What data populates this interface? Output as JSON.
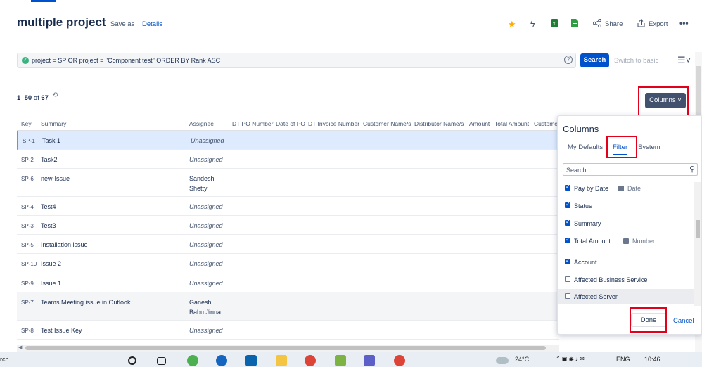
{
  "header": {
    "title": "multiple project",
    "save_as": "Save as",
    "details": "Details",
    "share": "Share",
    "export": "Export"
  },
  "search": {
    "query": "project = SP OR project = \"Component test\" ORDER BY Rank ASC",
    "search_button": "Search",
    "switch_label": "Switch to basic"
  },
  "results": {
    "range": "1–50",
    "of_label": "of",
    "total": "67",
    "columns_button": "Columns ˅"
  },
  "table": {
    "headers": [
      "Key",
      "Summary",
      "Assignee",
      "DT PO Number",
      "Date of PO",
      "DT Invoice Number",
      "Customer Name/s",
      "Distributor Name/s",
      "Amount",
      "Total Amount",
      "Custome"
    ],
    "rows": [
      {
        "key": "SP-1",
        "summary": "Task 1",
        "assignee": "Unassigned",
        "assignee2": ""
      },
      {
        "key": "SP-2",
        "summary": "Task2",
        "assignee": "Unassigned",
        "assignee2": ""
      },
      {
        "key": "SP-6",
        "summary": "new-Issue",
        "assignee": "Sandesh",
        "assignee2": "Shetty"
      },
      {
        "key": "SP-4",
        "summary": "Test4",
        "assignee": "Unassigned",
        "assignee2": ""
      },
      {
        "key": "SP-3",
        "summary": "Test3",
        "assignee": "Unassigned",
        "assignee2": ""
      },
      {
        "key": "SP-5",
        "summary": "Installation issue",
        "assignee": "Unassigned",
        "assignee2": ""
      },
      {
        "key": "SP-10",
        "summary": "Issue 2",
        "assignee": "Unassigned",
        "assignee2": ""
      },
      {
        "key": "SP-9",
        "summary": "Issue 1",
        "assignee": "Unassigned",
        "assignee2": ""
      },
      {
        "key": "SP-7",
        "summary": "Teams Meeting issue in Outlook",
        "assignee": "Ganesh",
        "assignee2": "Babu Jinna"
      },
      {
        "key": "SP-8",
        "summary": "Test Issue Key",
        "assignee": "Unassigned",
        "assignee2": ""
      }
    ]
  },
  "columns_popup": {
    "title": "Columns",
    "tabs": [
      "My Defaults",
      "Filter",
      "System"
    ],
    "active_tab": "Filter",
    "search_placeholder": "Search",
    "items": [
      {
        "label": "Pay by Date",
        "checked": true,
        "type": "Date"
      },
      {
        "label": "Status",
        "checked": true,
        "type": ""
      },
      {
        "label": "Summary",
        "checked": true,
        "type": ""
      },
      {
        "label": "Total Amount",
        "checked": true,
        "type": "Number"
      },
      {
        "label": "Account",
        "checked": true,
        "type": ""
      },
      {
        "label": "Affected Business Service",
        "checked": false,
        "type": ""
      },
      {
        "label": "Affected Server",
        "checked": false,
        "type": ""
      }
    ],
    "done": "Done",
    "cancel": "Cancel"
  },
  "taskbar": {
    "search_text": "rch",
    "weather": "24°C",
    "language": "ENG",
    "clock": "10:46"
  },
  "colors": {
    "accent": "#0052cc",
    "annotation_red": "#e3001b",
    "columns_button": "#42526e"
  }
}
